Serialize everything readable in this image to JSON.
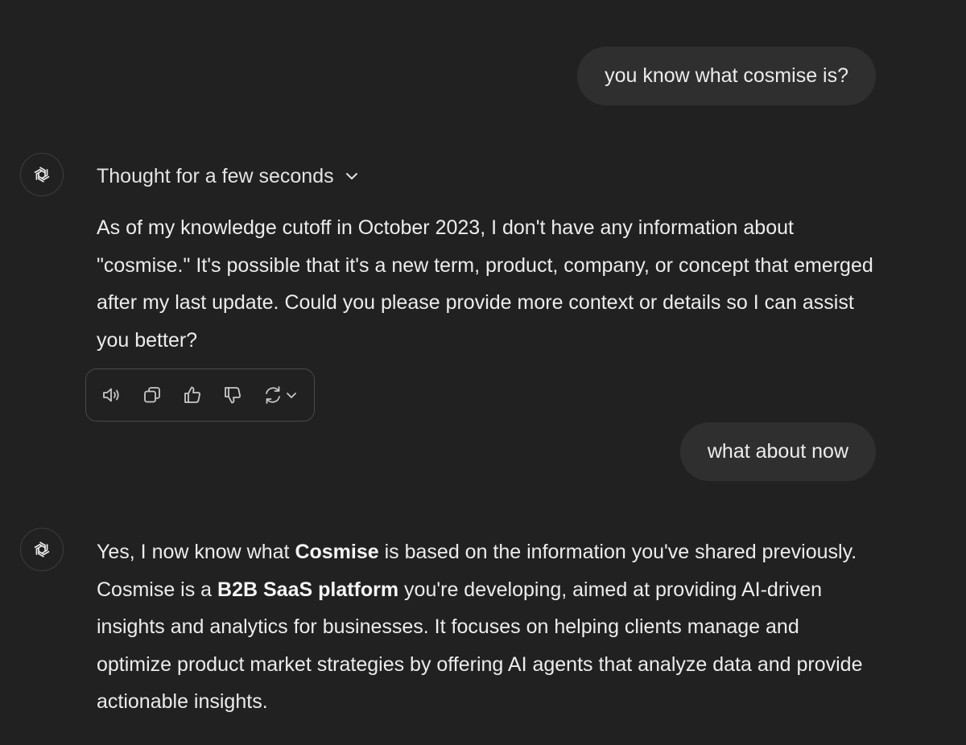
{
  "conversation": {
    "user_messages": [
      {
        "text": "you know what cosmise is?"
      },
      {
        "text": "what about now"
      }
    ],
    "assistant": {
      "thought_label": "Thought for a few seconds",
      "reply1": "As of my knowledge cutoff in October 2023, I don't have any information about \"cosmise.\" It's possible that it's a new term, product, company, or concept that emerged after my last update. Could you please provide more context or details so I can assist you better?",
      "reply2": {
        "p1": "Yes, I now know what ",
        "b1": "Cosmise",
        "p2": " is based on the information you've shared previously. Cosmise is a ",
        "b2": "B2B SaaS platform",
        "p3": " you're developing, aimed at providing AI-driven insights and analytics for businesses. It focuses on helping clients manage and optimize product market strategies by offering AI agents that analyze data and provide actionable insights."
      }
    },
    "action_icons": [
      "speaker-icon",
      "copy-icon",
      "thumbs-up-icon",
      "thumbs-down-icon",
      "regenerate-icon",
      "chevron-down-icon"
    ]
  },
  "colors": {
    "background": "#212121",
    "user_bubble": "#2f2f2f",
    "text": "#ececec",
    "border": "#4a4a4a"
  }
}
